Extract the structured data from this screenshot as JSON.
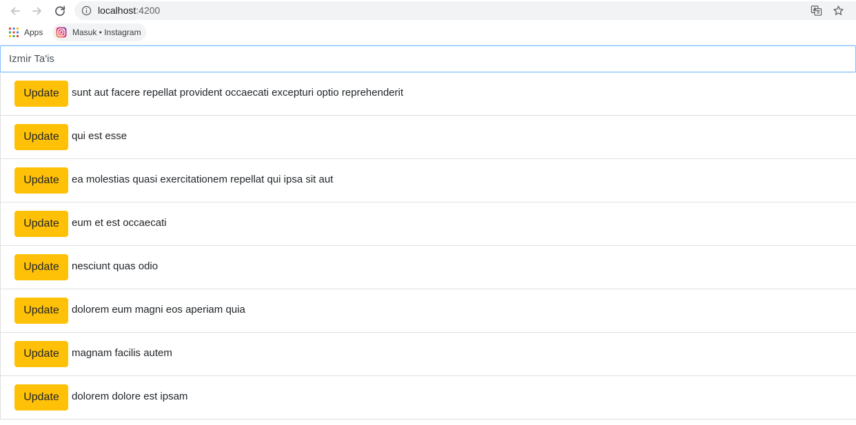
{
  "browser": {
    "url_host": "localhost",
    "url_port": ":4200",
    "bookmarks": [
      {
        "label": "Apps",
        "icon": "apps-grid-icon"
      },
      {
        "label": "Masuk • Instagram",
        "icon": "instagram-icon"
      }
    ]
  },
  "search": {
    "value": "Izmir Ta'is"
  },
  "posts": {
    "button_label": "Update",
    "items": [
      {
        "title": "sunt aut facere repellat provident occaecati excepturi optio reprehenderit"
      },
      {
        "title": "qui est esse"
      },
      {
        "title": "ea molestias quasi exercitationem repellat qui ipsa sit aut"
      },
      {
        "title": "eum et est occaecati"
      },
      {
        "title": "nesciunt quas odio"
      },
      {
        "title": "dolorem eum magni eos aperiam quia"
      },
      {
        "title": "magnam facilis autem"
      },
      {
        "title": "dolorem dolore est ipsam"
      }
    ]
  },
  "colors": {
    "button_bg": "#ffc107",
    "focus_border": "#80bdff",
    "divider": "#dfdfdf"
  }
}
